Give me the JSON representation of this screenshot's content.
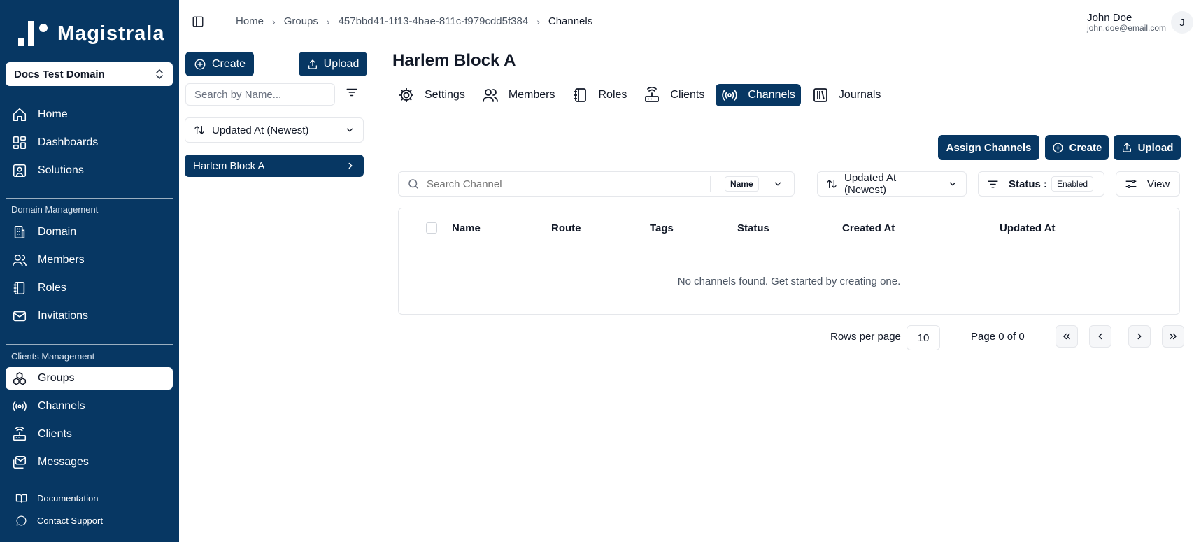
{
  "sidebar": {
    "brand": "Magistrala",
    "domain": "Docs Test Domain",
    "main_items": [
      {
        "label": "Home",
        "icon": "home-icon"
      },
      {
        "label": "Dashboards",
        "icon": "dashboards-icon"
      },
      {
        "label": "Solutions",
        "icon": "solutions-icon"
      }
    ],
    "domain_section": "Domain Management",
    "domain_items": [
      {
        "label": "Domain",
        "icon": "building-icon"
      },
      {
        "label": "Members",
        "icon": "users-icon"
      },
      {
        "label": "Roles",
        "icon": "roles-book-icon"
      },
      {
        "label": "Invitations",
        "icon": "mail-icon"
      }
    ],
    "clients_section": "Clients Management",
    "clients_items": [
      {
        "label": "Groups",
        "icon": "groups-icon",
        "active": true
      },
      {
        "label": "Channels",
        "icon": "radio-icon"
      },
      {
        "label": "Clients",
        "icon": "router-icon"
      },
      {
        "label": "Messages",
        "icon": "messages-icon"
      }
    ],
    "footer_items": [
      {
        "label": "Documentation",
        "icon": "book-open-icon"
      },
      {
        "label": "Contact Support",
        "icon": "chat-icon"
      }
    ]
  },
  "topbar": {
    "breadcrumb": [
      "Home",
      "Groups",
      "457bbd41-1f13-4bae-811c-f979cdd5f384",
      "Channels"
    ],
    "user": {
      "name": "John Doe",
      "email": "john.doe@email.com",
      "initial": "J"
    }
  },
  "groups_panel": {
    "create_label": "Create",
    "upload_label": "Upload",
    "search_placeholder": "Search by Name...",
    "sort_label": "Updated At (Newest)",
    "items": [
      "Harlem Block A"
    ]
  },
  "main": {
    "title": "Harlem Block A",
    "tabs": [
      {
        "label": "Settings",
        "icon": "gear-icon"
      },
      {
        "label": "Members",
        "icon": "users-icon"
      },
      {
        "label": "Roles",
        "icon": "roles-book-icon"
      },
      {
        "label": "Clients",
        "icon": "router-icon"
      },
      {
        "label": "Channels",
        "icon": "radio-icon",
        "active": true
      },
      {
        "label": "Journals",
        "icon": "journals-icon"
      }
    ],
    "actions": {
      "assign": "Assign Channels",
      "create": "Create",
      "upload": "Upload"
    },
    "search": {
      "placeholder": "Search Channel",
      "field": "Name"
    },
    "sort_label": "Updated At (Newest)",
    "status_label": "Status :",
    "status_value": "Enabled",
    "view_label": "View",
    "columns": [
      "Name",
      "Route",
      "Tags",
      "Status",
      "Created At",
      "Updated At"
    ],
    "empty_message": "No channels found. Get started by creating one.",
    "pagination": {
      "rows_label": "Rows per page",
      "rows_value": "10",
      "page_label": "Page 0 of 0"
    }
  },
  "colors": {
    "primary": "#073763",
    "border": "#e5e7eb",
    "text": "#111827"
  }
}
